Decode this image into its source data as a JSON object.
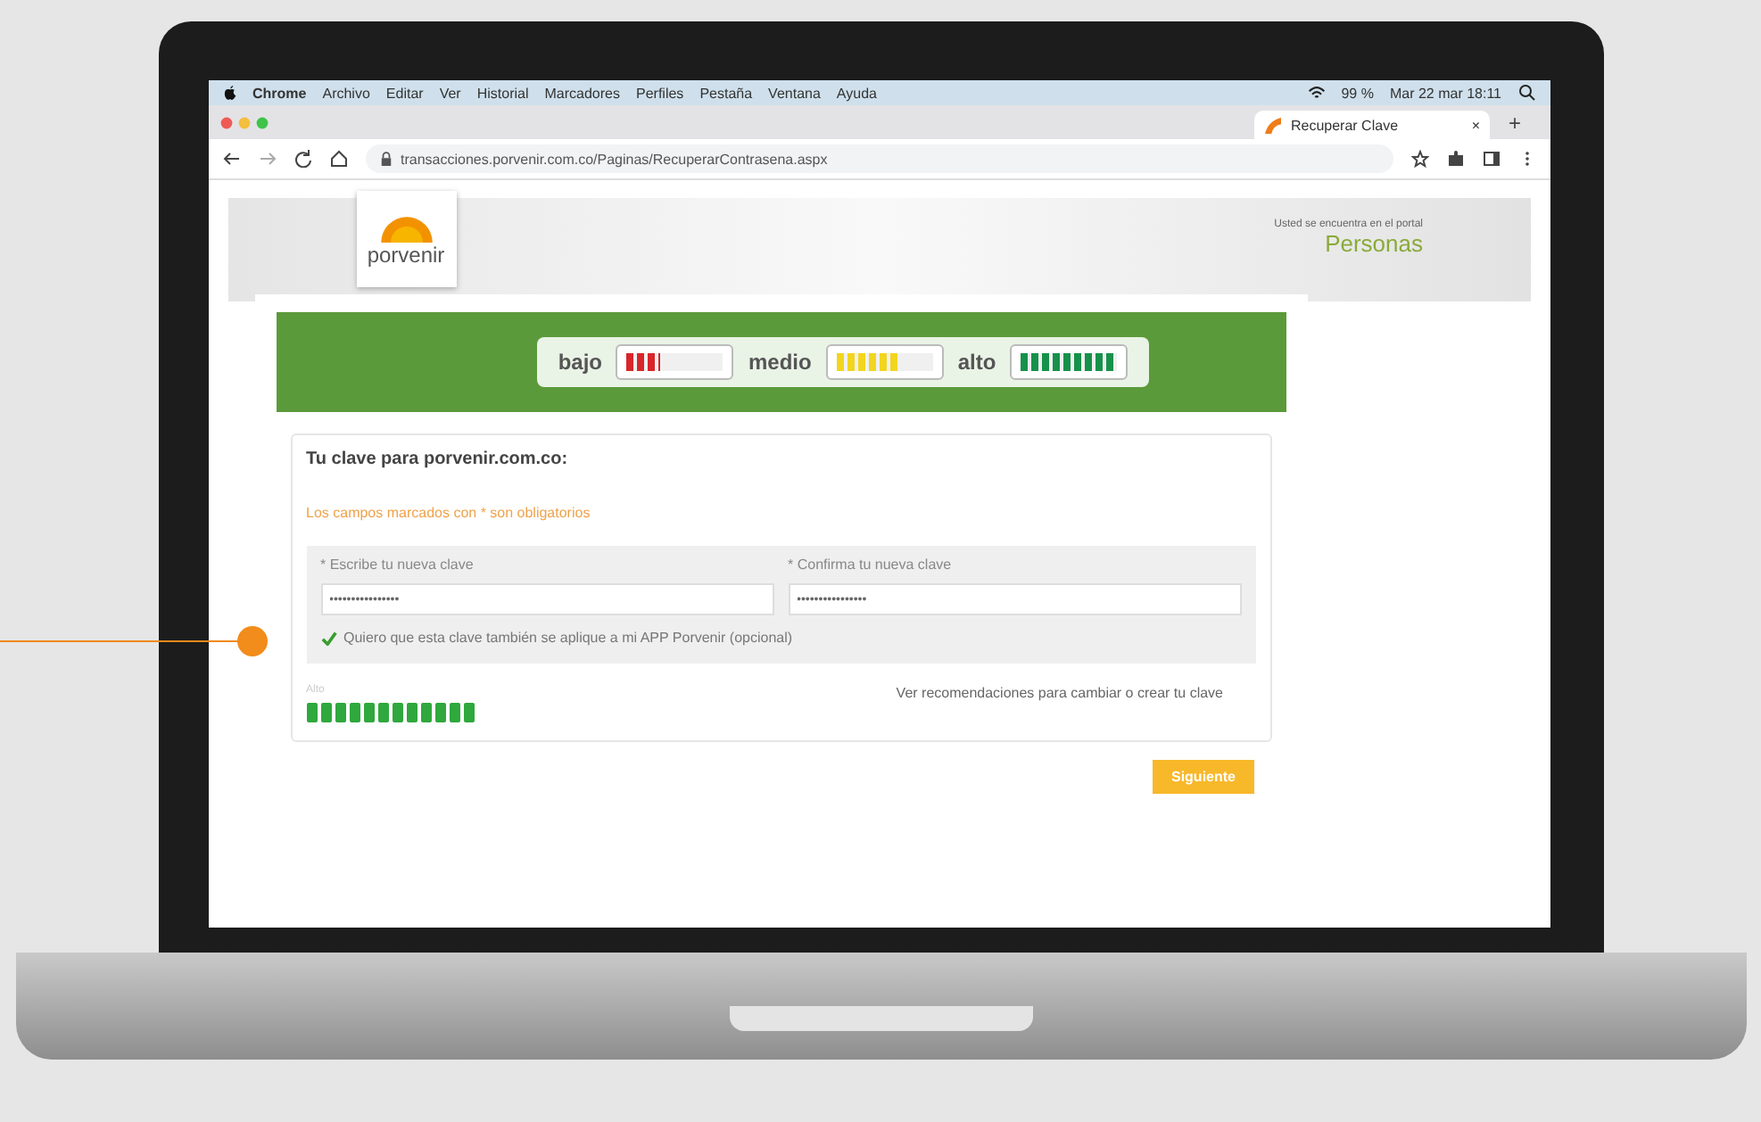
{
  "menubar": {
    "app": "Chrome",
    "items": [
      "Archivo",
      "Editar",
      "Ver",
      "Historial",
      "Marcadores",
      "Perfiles",
      "Pestaña",
      "Ventana",
      "Ayuda"
    ],
    "battery": "99 %",
    "clock": "Mar 22 mar  18:11"
  },
  "browser": {
    "tab": "Recuperar Clave",
    "new_tab": "+",
    "close": "×",
    "url": "transacciones.porvenir.com.co/Paginas/RecuperarContrasena.aspx"
  },
  "header": {
    "logo": "porvenir",
    "portal_note": "Usted se encuentra en el portal",
    "portal": "Personas"
  },
  "legend": [
    {
      "label": "bajo",
      "color": "#d9262b",
      "level": 0.34
    },
    {
      "label": "medio",
      "color": "#f2d51e",
      "level": 0.67
    },
    {
      "label": "alto",
      "color": "#17914a",
      "level": 1
    }
  ],
  "form": {
    "title": "Tu clave para porvenir.com.co:",
    "required_note": "Los campos marcados con * son obligatorios",
    "fields": [
      {
        "label": "* Escribe tu nueva clave",
        "value": "••••••••••••••••"
      },
      {
        "label": "* Confirma tu nueva clave",
        "value": "••••••••••••••••"
      }
    ],
    "checkbox": {
      "label": "Quiero que esta clave también se aplique a mi APP Porvenir (opcional)",
      "checked": true
    },
    "strength": {
      "label": "Alto",
      "level": 1
    },
    "link": "Ver recomendaciones para cambiar o crear tu clave",
    "button": "Siguiente"
  }
}
